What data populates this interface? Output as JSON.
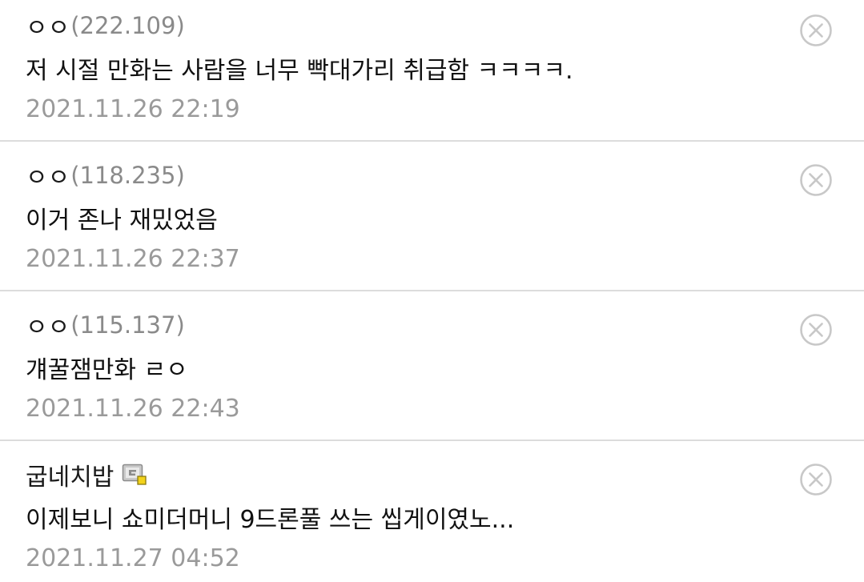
{
  "comments": [
    {
      "nickname": "ㅇㅇ",
      "ip": "(222.109)",
      "text": "저 시절 만화는 사람을 너무 빡대가리 취급함 ㅋㅋㅋㅋ.",
      "time": "2021.11.26 22:19",
      "member_icon": null
    },
    {
      "nickname": "ㅇㅇ",
      "ip": "(118.235)",
      "text": "이거 존나 재밌었음",
      "time": "2021.11.26 22:37",
      "member_icon": null
    },
    {
      "nickname": "ㅇㅇ",
      "ip": "(115.137)",
      "text": "걔꿀잼만화 ㄹㅇ",
      "time": "2021.11.26 22:43",
      "member_icon": null
    },
    {
      "nickname": "굽네치밥",
      "ip": "",
      "text": "이제보니 쇼미더머니 9드론풀 쓰는 씹게이였노...",
      "time": "2021.11.27 04:52",
      "member_icon": "fixed-nick-gallog-icon"
    }
  ],
  "colors": {
    "nickname": "#1a1a1a",
    "ip": "#8a8a8a",
    "timestamp": "#9a9a9a",
    "divider": "#dcdcdc",
    "delete_icon": "#c8c8c8"
  },
  "icons": {
    "delete": "close-circle-icon"
  }
}
